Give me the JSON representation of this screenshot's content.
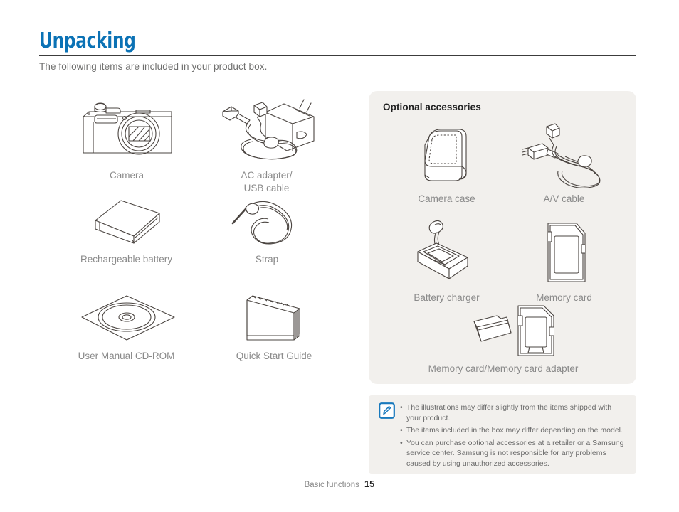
{
  "header": {
    "title": "Unpacking",
    "subtitle": "The following items are included in your product box.",
    "accent_color": "#0b72b5"
  },
  "included_items": [
    {
      "label": "Camera",
      "icon": "camera-icon"
    },
    {
      "label": "AC adapter/\nUSB cable",
      "icon": "ac-adapter-usb-cable-icon"
    },
    {
      "label": "Rechargeable battery",
      "icon": "battery-icon"
    },
    {
      "label": "Strap",
      "icon": "strap-icon"
    },
    {
      "label": "User Manual CD-ROM",
      "icon": "cd-rom-icon"
    },
    {
      "label": "Quick Start Guide",
      "icon": "quick-start-guide-icon"
    }
  ],
  "optional": {
    "heading": "Optional accessories",
    "panel_color": "#f2f0ed",
    "items": [
      {
        "label": "Camera case",
        "icon": "camera-case-icon"
      },
      {
        "label": "A/V cable",
        "icon": "av-cable-icon"
      },
      {
        "label": "Battery charger",
        "icon": "battery-charger-icon"
      },
      {
        "label": "Memory card",
        "icon": "memory-card-icon"
      },
      {
        "label": "Memory card/Memory card adapter",
        "icon": "memory-card-adapter-icon"
      }
    ]
  },
  "note": {
    "icon": "note-pencil-icon",
    "icon_color": "#1879bd",
    "bullet": "•",
    "items": [
      "The illustrations may differ slightly from the items shipped with your product.",
      "The items included in the box may differ depending on the model.",
      "You can purchase optional accessories at a retailer or a Samsung service center. Samsung is not responsible for any problems caused by using unauthorized accessories."
    ]
  },
  "footer": {
    "section": "Basic functions",
    "page": "15"
  }
}
